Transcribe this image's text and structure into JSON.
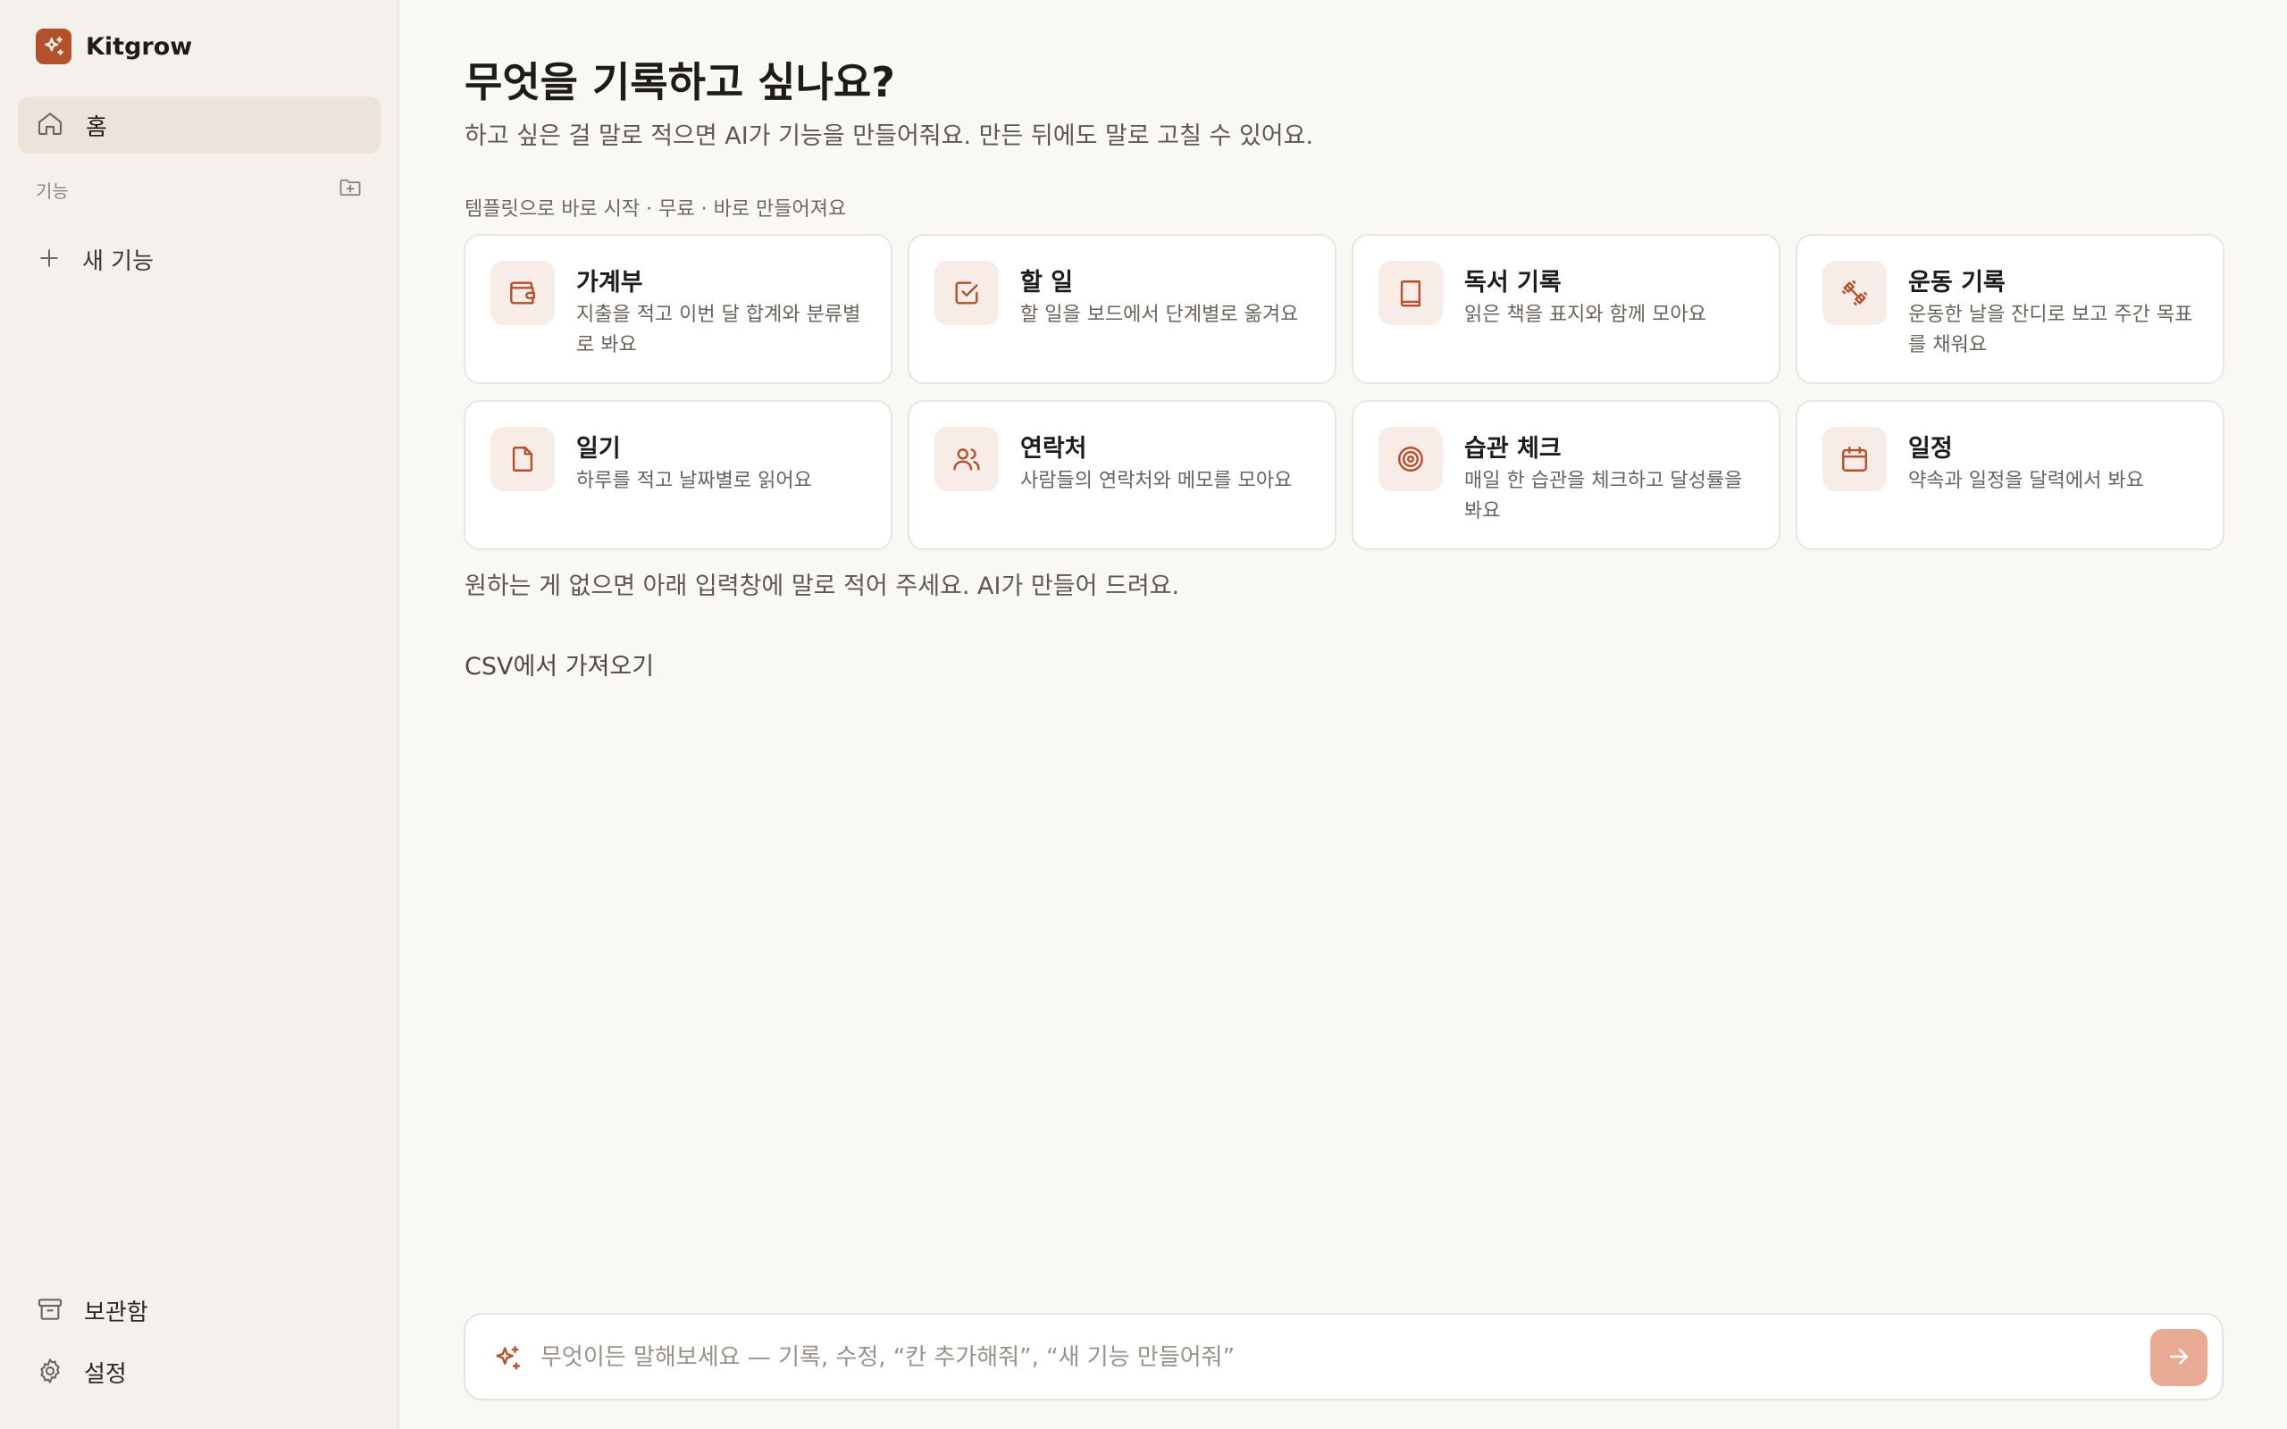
{
  "brand": {
    "name": "Kitgrow",
    "icon": "sparkles-icon",
    "accent": "#b4502a"
  },
  "sidebar": {
    "home_label": "홈",
    "section_label": "기능",
    "new_feature_label": "새 기능",
    "archive_label": "보관함",
    "settings_label": "설정"
  },
  "main": {
    "title": "무엇을 기록하고 싶나요?",
    "subtitle": "하고 싶은 걸 말로 적으면 AI가 기능을 만들어줘요. 만든 뒤에도 말로 고칠 수 있어요.",
    "templates_caption": "템플릿으로 바로 시작 · 무료 · 바로 만들어져요",
    "templates": [
      {
        "title": "가계부",
        "desc": "지출을 적고 이번 달 합계와 분류별로 봐요",
        "icon": "wallet-icon"
      },
      {
        "title": "할 일",
        "desc": "할 일을 보드에서 단계별로 옮겨요",
        "icon": "checkbox-icon"
      },
      {
        "title": "독서 기록",
        "desc": "읽은 책을 표지와 함께 모아요",
        "icon": "book-icon"
      },
      {
        "title": "운동 기록",
        "desc": "운동한 날을 잔디로 보고 주간 목표를 채워요",
        "icon": "dumbbell-icon"
      },
      {
        "title": "일기",
        "desc": "하루를 적고 날짜별로 읽어요",
        "icon": "note-icon"
      },
      {
        "title": "연락처",
        "desc": "사람들의 연락처와 메모를 모아요",
        "icon": "users-icon"
      },
      {
        "title": "습관 체크",
        "desc": "매일 한 습관을 체크하고 달성률을 봐요",
        "icon": "target-icon"
      },
      {
        "title": "일정",
        "desc": "약속과 일정을 달력에서 봐요",
        "icon": "calendar-icon"
      }
    ],
    "hint": "원하는 게 없으면 아래 입력창에 말로 적어 주세요. AI가 만들어 드려요.",
    "csv_import_label": "CSV에서 가져오기"
  },
  "composer": {
    "placeholder": "무엇이든 말해보세요 — 기록, 수정, “칸 추가해줘”, “새 기능 만들어줘”",
    "value": "",
    "send_color": "#e9ab94"
  }
}
